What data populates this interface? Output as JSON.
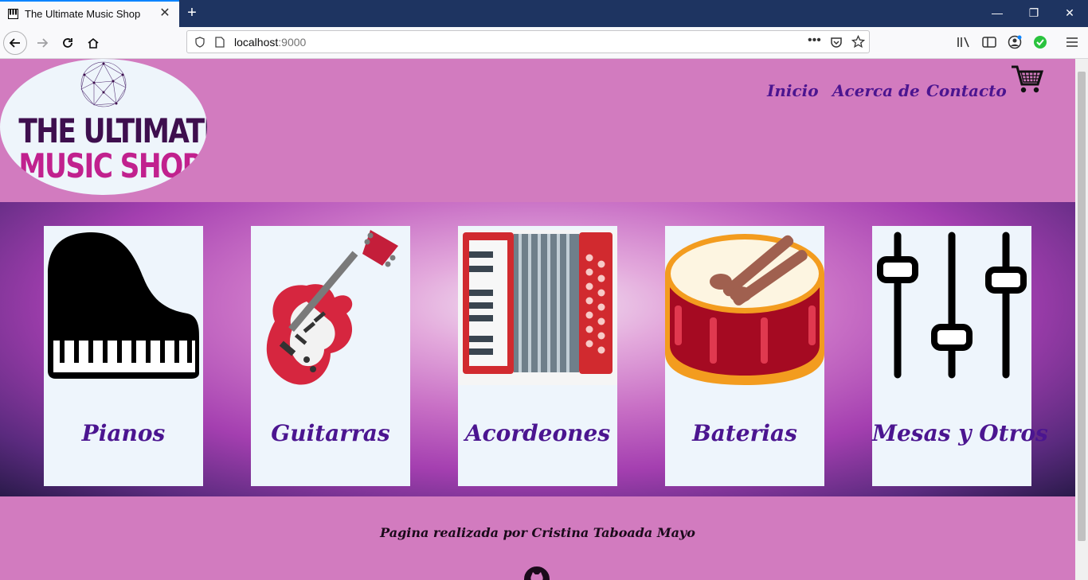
{
  "browser": {
    "tab_title": "The Ultimate Music Shop",
    "url_host": "localhost",
    "url_port": ":9000"
  },
  "header": {
    "logo_line1": "THE ULTIMATE",
    "logo_line2": "MUSIC SHOP",
    "nav": [
      {
        "label": "Inicio"
      },
      {
        "label": "Acerca de"
      },
      {
        "label": "Contacto"
      }
    ]
  },
  "categories": [
    {
      "label": "Pianos",
      "icon": "piano-icon"
    },
    {
      "label": "Guitarras",
      "icon": "guitar-icon"
    },
    {
      "label": "Acordeones",
      "icon": "accordion-icon"
    },
    {
      "label": "Baterias",
      "icon": "drum-icon"
    },
    {
      "label": "Mesas y Otros",
      "icon": "mixer-icon"
    }
  ],
  "footer": {
    "credit": "Pagina realizada por Cristina Taboada Mayo"
  },
  "colors": {
    "page_bg": "#d27bbf",
    "accent_text": "#4b1590",
    "card_bg": "#eef5fc"
  }
}
